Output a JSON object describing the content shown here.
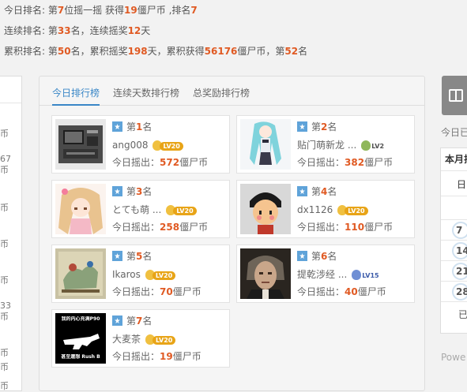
{
  "summary": {
    "today": {
      "p1": "今日排名: 第",
      "rank": "7",
      "p2": "位摇一摇 获得",
      "coins": "19",
      "p3": "僵尸币 ,排名",
      "rank2": "7"
    },
    "streak": {
      "p1": "连续排名: 第",
      "rank": "33",
      "p2": "名，连续摇奖",
      "days": "12",
      "p3": "天"
    },
    "total": {
      "p1": "累积排名: 第",
      "rank": "50",
      "p2": "名，累积摇奖",
      "days": "198",
      "p3": "天，累积获得",
      "coins": "56176",
      "p4": "僵尸币，第",
      "rank2": "52",
      "p5": "名"
    }
  },
  "left_items": [
    "币",
    "67",
    "币",
    "币",
    "币",
    "币",
    "币",
    "33",
    "币",
    "币",
    "币"
  ],
  "tabs": [
    "今日排行榜",
    "连续天数排行榜",
    "总奖励排行榜"
  ],
  "cards": [
    {
      "rank_prefix": "第",
      "rank": "1",
      "rank_suffix": "名",
      "name": "ang008",
      "level": "LV20",
      "shake_label": "今日摇出：",
      "value": "572",
      "unit": "僵尸币"
    },
    {
      "rank_prefix": "第",
      "rank": "2",
      "rank_suffix": "名",
      "name": "贴门萌新龙 ...",
      "level": "LV2",
      "shake_label": "今日摇出：",
      "value": "382",
      "unit": "僵尸币"
    },
    {
      "rank_prefix": "第",
      "rank": "3",
      "rank_suffix": "名",
      "name": "とても萌 ...",
      "level": "LV20",
      "shake_label": "今日摇出：",
      "value": "258",
      "unit": "僵尸币"
    },
    {
      "rank_prefix": "第",
      "rank": "4",
      "rank_suffix": "名",
      "name": "dx1126",
      "level": "LV20",
      "shake_label": "今日摇出：",
      "value": "110",
      "unit": "僵尸币"
    },
    {
      "rank_prefix": "第",
      "rank": "5",
      "rank_suffix": "名",
      "name": "Ikaros",
      "level": "LV20",
      "shake_label": "今日摇出：",
      "value": "70",
      "unit": "僵尸币"
    },
    {
      "rank_prefix": "第",
      "rank": "6",
      "rank_suffix": "名",
      "name": "提乾涉经 ...",
      "level": "LV15",
      "shake_label": "今日摇出：",
      "value": "40",
      "unit": "僵尸币"
    },
    {
      "rank_prefix": "第",
      "rank": "7",
      "rank_suffix": "名",
      "name": "大麦茶",
      "level": "LV20",
      "shake_label": "今日摇出：",
      "value": "19",
      "unit": "僵尸币"
    }
  ],
  "avatar7": {
    "line1": "我的内心充满P90",
    "line2": "甚至還想 Rush B"
  },
  "right": {
    "today_label": "今日已",
    "calendar_title": "本月排",
    "weekday": "日",
    "days": [
      "7",
      "14",
      "21",
      "28"
    ],
    "footer_cell": "已",
    "powered": "Powe"
  }
}
